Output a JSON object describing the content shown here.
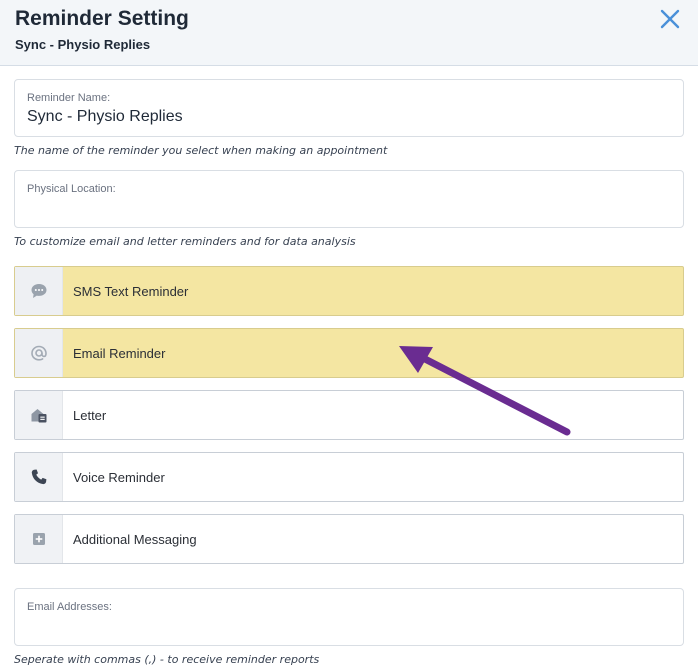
{
  "header": {
    "title": "Reminder Setting",
    "subtitle": "Sync - Physio Replies",
    "close_icon": "close-icon"
  },
  "fields": {
    "reminder_name": {
      "label": "Reminder Name:",
      "value": "Sync - Physio Replies",
      "hint": "The name of the reminder you select when making an appointment"
    },
    "physical_location": {
      "label": "Physical Location:",
      "value": "",
      "hint": "To customize email and letter reminders and for data analysis"
    },
    "email_addresses": {
      "label": "Email Addresses:",
      "value": "",
      "hint": "Seperate with commas (,) - to receive reminder reports"
    }
  },
  "reminder_types": [
    {
      "label": "SMS Text Reminder",
      "icon": "chat-bubble-icon",
      "selected": true
    },
    {
      "label": "Email Reminder",
      "icon": "at-sign-icon",
      "selected": true
    },
    {
      "label": "Letter",
      "icon": "mailbox-icon",
      "selected": false
    },
    {
      "label": "Voice Reminder",
      "icon": "phone-icon",
      "selected": false
    },
    {
      "label": "Additional Messaging",
      "icon": "plus-square-icon",
      "selected": false
    }
  ],
  "colors": {
    "selected_row": "#f4e6a2",
    "accent_close": "#4a90d9",
    "annotation_arrow": "#6a2c91"
  }
}
